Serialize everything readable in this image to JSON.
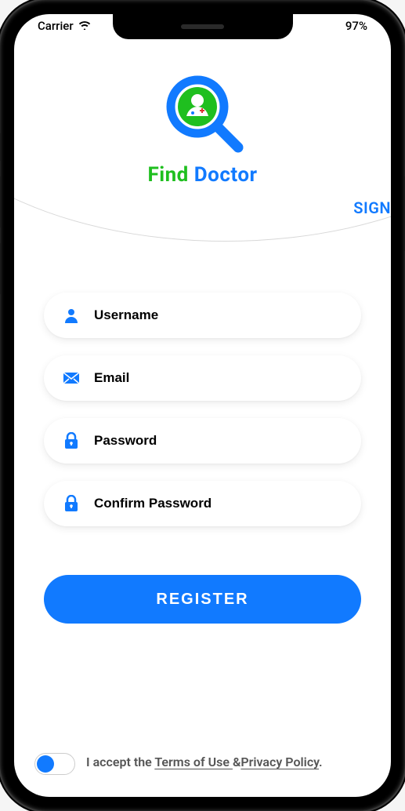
{
  "statusBar": {
    "carrier": "Carrier",
    "battery": "97%"
  },
  "brand": {
    "word1": "Find",
    "word2": "Doctor"
  },
  "signLink": "SIGN",
  "fields": {
    "username": {
      "placeholder": "Username"
    },
    "email": {
      "placeholder": "Email"
    },
    "password": {
      "placeholder": "Password"
    },
    "confirm": {
      "placeholder": "Confirm Password"
    }
  },
  "registerLabel": "REGISTER",
  "terms": {
    "prefix": "I accept the ",
    "termsOfUse": "Terms of Use ",
    "amp": "&",
    "privacy": "Privacy Policy",
    "suffix": "."
  },
  "toggle": {
    "on": true
  },
  "colors": {
    "primary": "#117aff",
    "accent": "#1fbf1f"
  }
}
